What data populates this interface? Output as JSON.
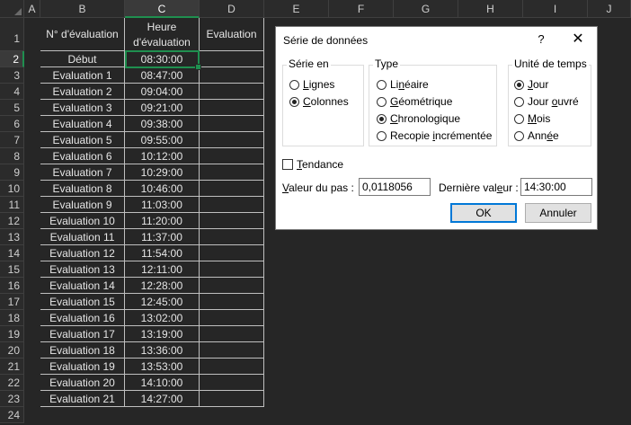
{
  "columns": [
    "A",
    "B",
    "C",
    "D",
    "E",
    "F",
    "G",
    "H",
    "I",
    "J"
  ],
  "rows": [
    "1",
    "2",
    "3",
    "4",
    "5",
    "6",
    "7",
    "8",
    "9",
    "10",
    "11",
    "12",
    "13",
    "14",
    "15",
    "16",
    "17",
    "18",
    "19",
    "20",
    "21",
    "22",
    "23",
    "24"
  ],
  "headers": {
    "b": "N° d'évaluation",
    "c_line1": "Heure",
    "c_line2": "d'évaluation",
    "d": "Evaluation"
  },
  "table": [
    {
      "label": "Début",
      "time": "08:30:00"
    },
    {
      "label": "Evaluation 1",
      "time": "08:47:00"
    },
    {
      "label": "Evaluation 2",
      "time": "09:04:00"
    },
    {
      "label": "Evaluation 3",
      "time": "09:21:00"
    },
    {
      "label": "Evaluation 4",
      "time": "09:38:00"
    },
    {
      "label": "Evaluation 5",
      "time": "09:55:00"
    },
    {
      "label": "Evaluation 6",
      "time": "10:12:00"
    },
    {
      "label": "Evaluation 7",
      "time": "10:29:00"
    },
    {
      "label": "Evaluation 8",
      "time": "10:46:00"
    },
    {
      "label": "Evaluation 9",
      "time": "11:03:00"
    },
    {
      "label": "Evaluation 10",
      "time": "11:20:00"
    },
    {
      "label": "Evaluation 11",
      "time": "11:37:00"
    },
    {
      "label": "Evaluation 12",
      "time": "11:54:00"
    },
    {
      "label": "Evaluation 13",
      "time": "12:11:00"
    },
    {
      "label": "Evaluation 14",
      "time": "12:28:00"
    },
    {
      "label": "Evaluation 15",
      "time": "12:45:00"
    },
    {
      "label": "Evaluation 16",
      "time": "13:02:00"
    },
    {
      "label": "Evaluation 17",
      "time": "13:19:00"
    },
    {
      "label": "Evaluation 18",
      "time": "13:36:00"
    },
    {
      "label": "Evaluation 19",
      "time": "13:53:00"
    },
    {
      "label": "Evaluation 20",
      "time": "14:10:00"
    },
    {
      "label": "Evaluation 21",
      "time": "14:27:00"
    }
  ],
  "dialog": {
    "title": "Série de données",
    "help": "?",
    "close": "✕",
    "serie": {
      "label": "Série en",
      "lignes": {
        "pre": "",
        "u": "L",
        "post": "ignes"
      },
      "colonnes": {
        "pre": "",
        "u": "C",
        "post": "olonnes"
      }
    },
    "type": {
      "label": "Type",
      "lineaire": {
        "pre": "Li",
        "u": "n",
        "post": "éaire"
      },
      "geometrique": {
        "pre": "",
        "u": "G",
        "post": "éométrique"
      },
      "chrono": {
        "pre": "",
        "u": "C",
        "post": "hronologique"
      },
      "recopie": {
        "pre": "Recopie ",
        "u": "i",
        "post": "ncrémentée"
      }
    },
    "unite": {
      "label": "Unité de temps",
      "jour": {
        "pre": "",
        "u": "J",
        "post": "our"
      },
      "jour_ouvre": {
        "pre": "Jour ",
        "u": "o",
        "post": "uvré"
      },
      "mois": {
        "pre": "",
        "u": "M",
        "post": "ois"
      },
      "annee": {
        "pre": "Ann",
        "u": "é",
        "post": "e"
      }
    },
    "tendance": {
      "pre": "",
      "u": "T",
      "post": "endance"
    },
    "pas": {
      "pre": "",
      "u": "V",
      "post": "aleur du pas :"
    },
    "pas_value": "0,0118056",
    "derniere": {
      "pre": "Dernière val",
      "u": "e",
      "post": "ur :"
    },
    "derniere_value": "14:30:00",
    "ok": "OK",
    "annuler": "Annuler"
  },
  "colors": {
    "selection": "#1f8f4f",
    "button_focus": "#0078d7"
  }
}
